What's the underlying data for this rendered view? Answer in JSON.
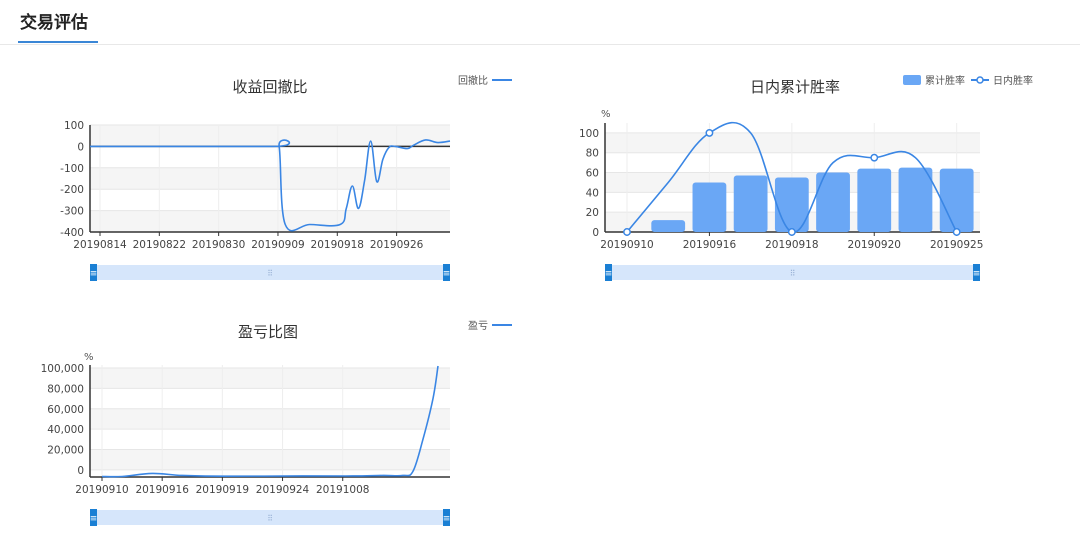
{
  "page": {
    "title": "交易评估"
  },
  "colors": {
    "line": "#3a86e4",
    "bar": "#6aa7f5",
    "zoom_bg": "#d6e6fb",
    "zoom_handle": "#1a7fd4"
  },
  "chart_data": [
    {
      "id": "drawdown",
      "type": "line",
      "title": "收益回撤比",
      "legend": [
        "回撤比"
      ],
      "unit": "",
      "x_ticks": [
        "20190814",
        "20190822",
        "20190830",
        "20190909",
        "20190918",
        "20190926"
      ],
      "ylim": [
        -400,
        100
      ],
      "y_ticks": [
        100,
        0,
        -100,
        -200,
        -300,
        -400
      ],
      "series": [
        {
          "name": "回撤比",
          "points": [
            [
              0,
              0
            ],
            [
              30,
              0
            ],
            [
              31,
              0
            ],
            [
              32,
              -365
            ],
            [
              36,
              -365
            ],
            [
              41,
              -365
            ],
            [
              42,
              -290
            ],
            [
              43,
              -185
            ],
            [
              44,
              -290
            ],
            [
              45,
              -160
            ],
            [
              46,
              25
            ],
            [
              47,
              -165
            ],
            [
              48,
              -60
            ],
            [
              49,
              -5
            ],
            [
              50,
              0
            ],
            [
              52,
              -10
            ],
            [
              53,
              5
            ],
            [
              55,
              30
            ],
            [
              57,
              18
            ],
            [
              59,
              25
            ]
          ]
        }
      ],
      "x_domain": [
        0,
        59
      ],
      "x_tick_pos": [
        0,
        10,
        20,
        30,
        40,
        50
      ]
    },
    {
      "id": "winrate",
      "type": "bar",
      "title": "日内累计胜率",
      "legend": [
        "累计胜率",
        "日内胜率"
      ],
      "unit": "%",
      "x_ticks": [
        "20190910",
        "20190916",
        "20190918",
        "20190920",
        "20190925"
      ],
      "ylim": [
        0,
        110
      ],
      "y_ticks": [
        100,
        80,
        60,
        40,
        20,
        0
      ],
      "bars": [
        0,
        12,
        50,
        57,
        55,
        60,
        64,
        65,
        64
      ],
      "line": [
        0,
        50,
        100,
        100,
        0,
        70,
        75,
        75,
        0
      ],
      "x_tick_pos": [
        0,
        2,
        4,
        6,
        8
      ]
    },
    {
      "id": "pnl",
      "type": "line",
      "title": "盈亏比图",
      "legend": [
        "盈亏"
      ],
      "unit": "%",
      "x_ticks": [
        "20190910",
        "20190916",
        "20190919",
        "20190924",
        "20191008"
      ],
      "ylim": [
        -7000,
        103000
      ],
      "y_ticks": [
        100000,
        80000,
        60000,
        40000,
        20000,
        0
      ],
      "y_tick_labels": [
        "100,000",
        "80,000",
        "60,000",
        "40,000",
        "20,000",
        "0"
      ],
      "series": [
        {
          "name": "盈亏",
          "points": [
            [
              0,
              -6500
            ],
            [
              2,
              -6500
            ],
            [
              5,
              -3500
            ],
            [
              8,
              -5500
            ],
            [
              12,
              -6200
            ],
            [
              20,
              -6000
            ],
            [
              25,
              -6000
            ],
            [
              28,
              -5500
            ],
            [
              30,
              -5500
            ],
            [
              31,
              -1500
            ],
            [
              32,
              30000
            ],
            [
              33,
              70000
            ],
            [
              33.5,
              102000
            ]
          ]
        }
      ],
      "x_domain": [
        0,
        33.5
      ],
      "x_tick_pos": [
        0,
        6,
        12,
        18,
        24
      ]
    }
  ]
}
